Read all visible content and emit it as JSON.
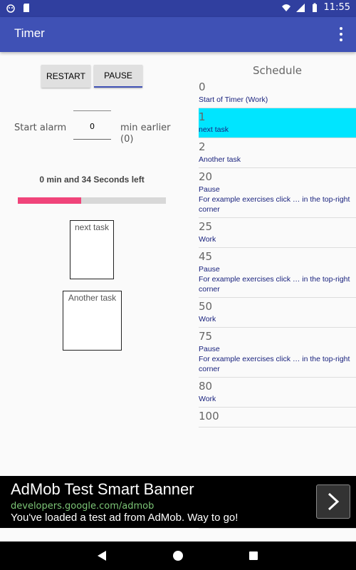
{
  "status_bar": {
    "time": "11:55"
  },
  "app_bar": {
    "title": "Timer"
  },
  "controls": {
    "restart_label": "RESTART",
    "pause_label": "PAUSE"
  },
  "alarm": {
    "label": "Start alarm",
    "value": "0",
    "suffix_line1": "min earlier",
    "suffix_line2": "(0)"
  },
  "timer": {
    "time_left": "0 min and 34 Seconds left",
    "progress_fraction": 0.43
  },
  "tasks": {
    "current": "next task",
    "upcoming": "Another task"
  },
  "schedule": {
    "title": "Schedule",
    "items": [
      {
        "time": "0",
        "desc": "Start of Timer (Work)"
      },
      {
        "time": "1",
        "desc": "next task"
      },
      {
        "time": "2",
        "desc": "Another task"
      },
      {
        "time": "20",
        "desc": "Pause\nFor example exercises click … in the top-right corner"
      },
      {
        "time": "25",
        "desc": "Work"
      },
      {
        "time": "45",
        "desc": "Pause\nFor example exercises click … in the top-right corner"
      },
      {
        "time": "50",
        "desc": "Work"
      },
      {
        "time": "75",
        "desc": "Pause\nFor example exercises click … in the top-right corner"
      },
      {
        "time": "80",
        "desc": "Work"
      },
      {
        "time": "100",
        "desc": ""
      }
    ],
    "active_index": 1
  },
  "ad": {
    "title": "AdMob Test Smart Banner",
    "url": "developers.google.com/admob",
    "description": "You've loaded a test ad from AdMob. Way to go!"
  },
  "colors": {
    "primary": "#3f51b5",
    "primary_dark": "#303f9f",
    "accent": "#f0447a",
    "highlight": "#00e5ff"
  }
}
